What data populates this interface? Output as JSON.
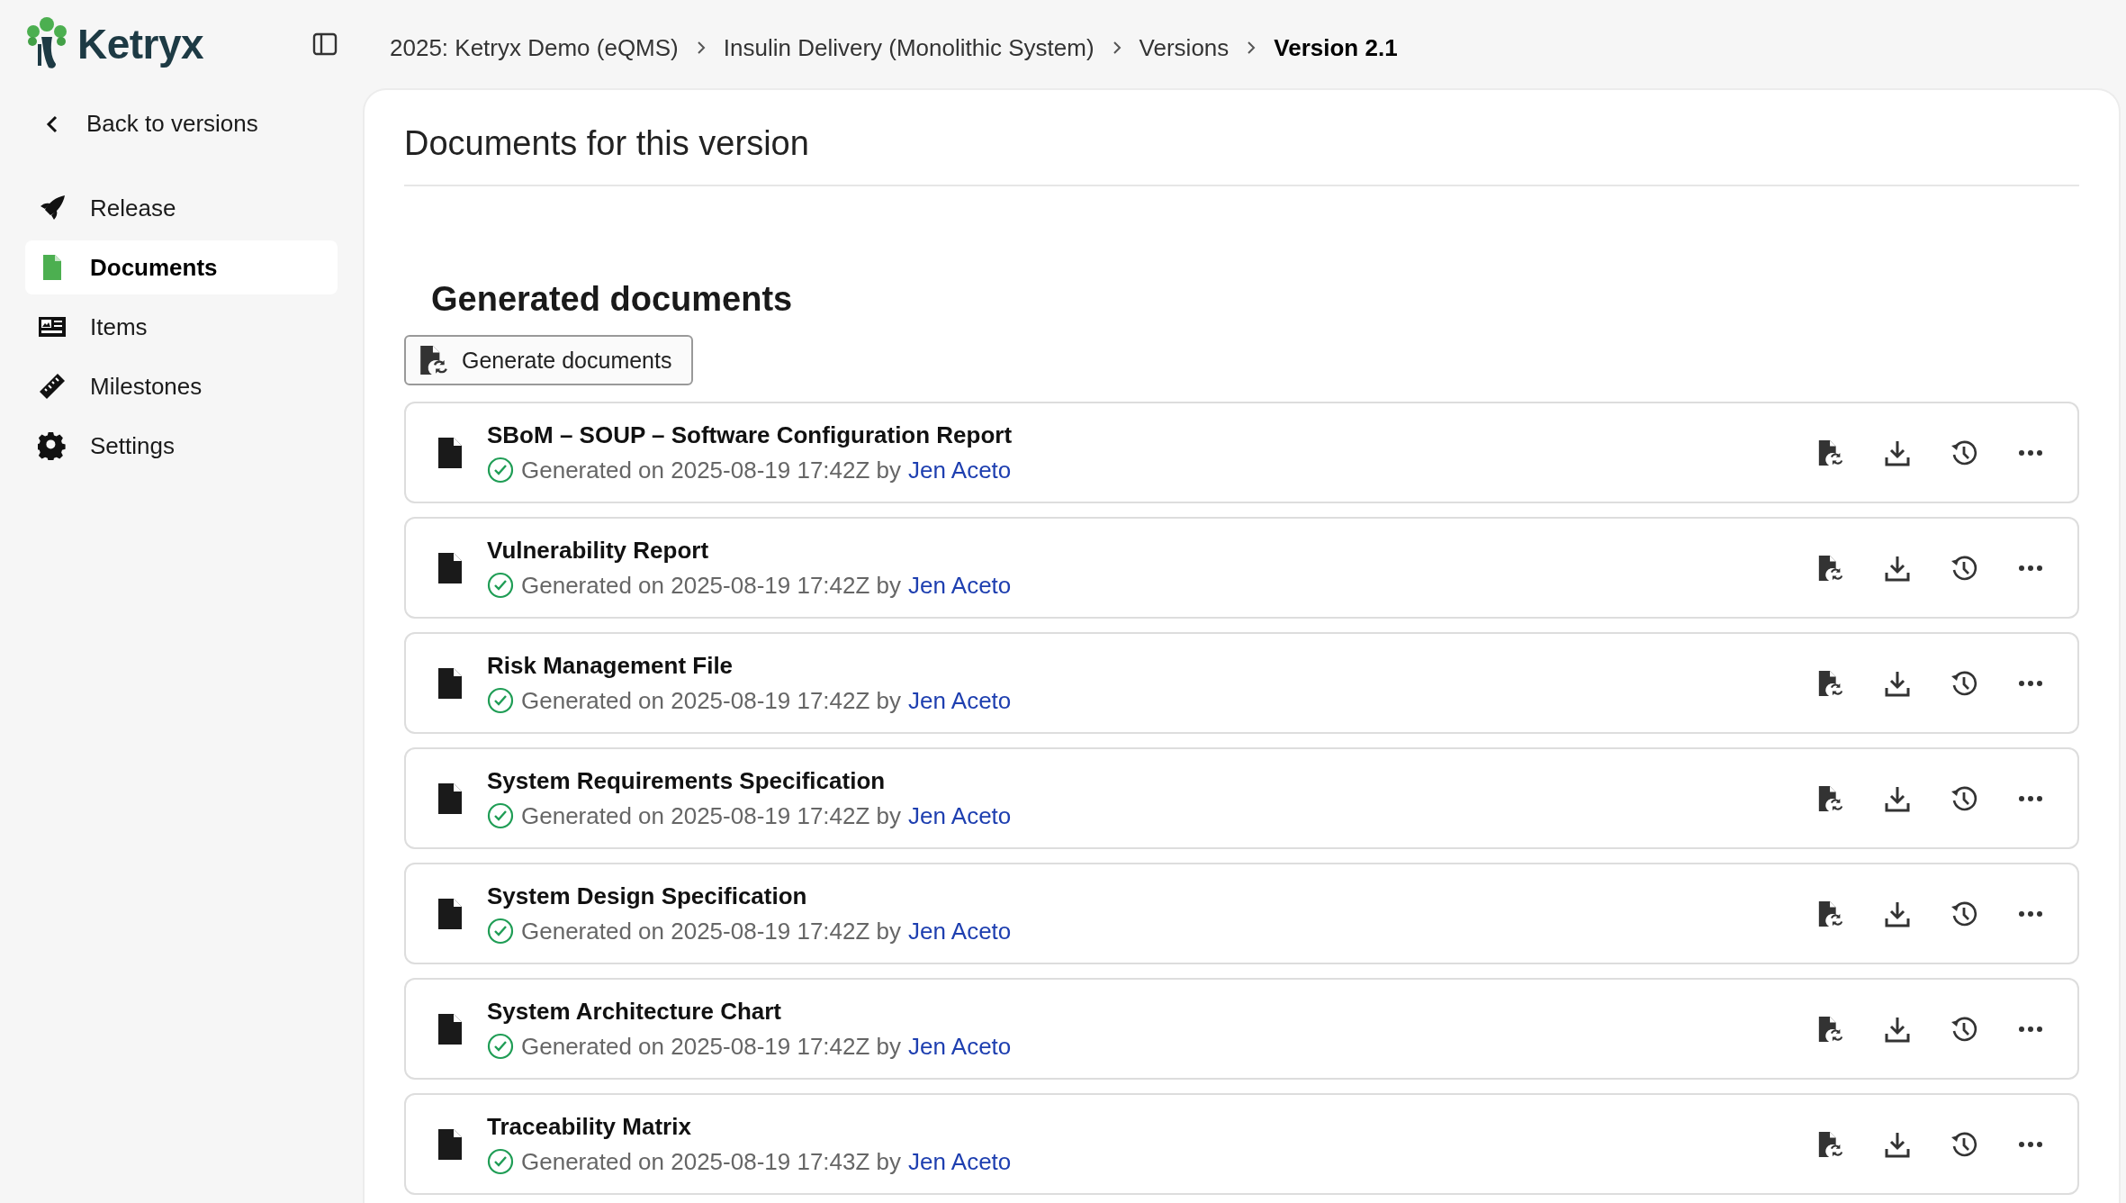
{
  "brand": {
    "name": "Ketryx"
  },
  "breadcrumbs": [
    {
      "label": "2025: Ketryx Demo (eQMS)",
      "current": false
    },
    {
      "label": "Insulin Delivery (Monolithic System)",
      "current": false
    },
    {
      "label": "Versions",
      "current": false
    },
    {
      "label": "Version 2.1",
      "current": true
    }
  ],
  "sidebar": {
    "back_link": "Back to versions",
    "items": [
      {
        "label": "Release",
        "kind": "rocket",
        "selected": false
      },
      {
        "label": "Documents",
        "kind": "document",
        "selected": true
      },
      {
        "label": "Items",
        "kind": "card",
        "selected": false
      },
      {
        "label": "Milestones",
        "kind": "ruler",
        "selected": false
      },
      {
        "label": "Settings",
        "kind": "gear",
        "selected": false
      }
    ]
  },
  "page_title": "Documents for this version",
  "section": {
    "title": "Generated documents",
    "button": "Generate documents",
    "documents": [
      {
        "title": "SBoM – SOUP – Software Configuration Report",
        "status": "Generated on 2025-08-19 17:42Z by",
        "author": "Jen Aceto"
      },
      {
        "title": "Vulnerability Report",
        "status": "Generated on 2025-08-19 17:42Z by",
        "author": "Jen Aceto"
      },
      {
        "title": "Risk Management File",
        "status": "Generated on 2025-08-19 17:42Z by",
        "author": "Jen Aceto"
      },
      {
        "title": "System Requirements Specification",
        "status": "Generated on 2025-08-19 17:42Z by",
        "author": "Jen Aceto"
      },
      {
        "title": "System Design Specification",
        "status": "Generated on 2025-08-19 17:42Z by",
        "author": "Jen Aceto"
      },
      {
        "title": "System Architecture Chart",
        "status": "Generated on 2025-08-19 17:42Z by",
        "author": "Jen Aceto"
      },
      {
        "title": "Traceability Matrix",
        "status": "Generated on 2025-08-19 17:43Z by",
        "author": "Jen Aceto"
      }
    ]
  }
}
